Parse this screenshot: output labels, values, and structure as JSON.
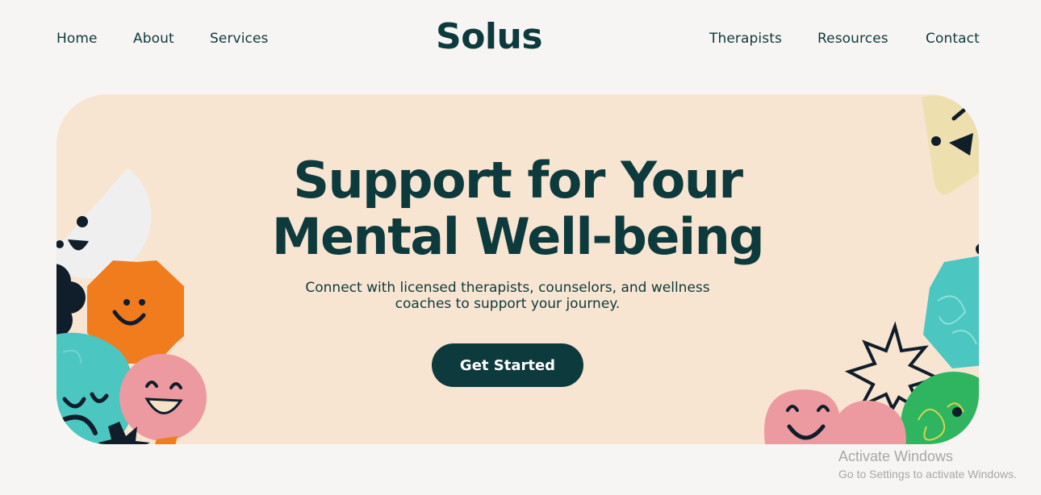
{
  "nav": {
    "left": [
      {
        "label": "Home"
      },
      {
        "label": "About"
      },
      {
        "label": "Services"
      }
    ],
    "brand": "Solus",
    "right": [
      {
        "label": "Therapists"
      },
      {
        "label": "Resources"
      },
      {
        "label": "Contact"
      }
    ]
  },
  "hero": {
    "title_line1": "Support for Your",
    "title_line2": "Mental Well-being",
    "subtitle_line1": "Connect with licensed therapists, counselors, and wellness",
    "subtitle_line2": "coaches to support your journey.",
    "cta_label": "Get Started",
    "colors": {
      "background": "#f8e5d1",
      "accent_dark": "#0d3a3c",
      "orange": "#f07c1d",
      "teal": "#4cc6c0",
      "pink": "#ec9aa0",
      "green": "#2fb45f",
      "cream": "#eedfae"
    },
    "decorations": [
      "white-half-circle-face",
      "orange-hexagon-face",
      "teal-blob-face",
      "pink-circle-face",
      "black-cloud",
      "black-star-flower",
      "cream-triangle-face",
      "teal-hexagon",
      "outline-star",
      "pink-heart-face",
      "green-circle-face"
    ]
  },
  "watermark": {
    "line1": "Activate Windows",
    "line2": "Go to Settings to activate Windows."
  }
}
